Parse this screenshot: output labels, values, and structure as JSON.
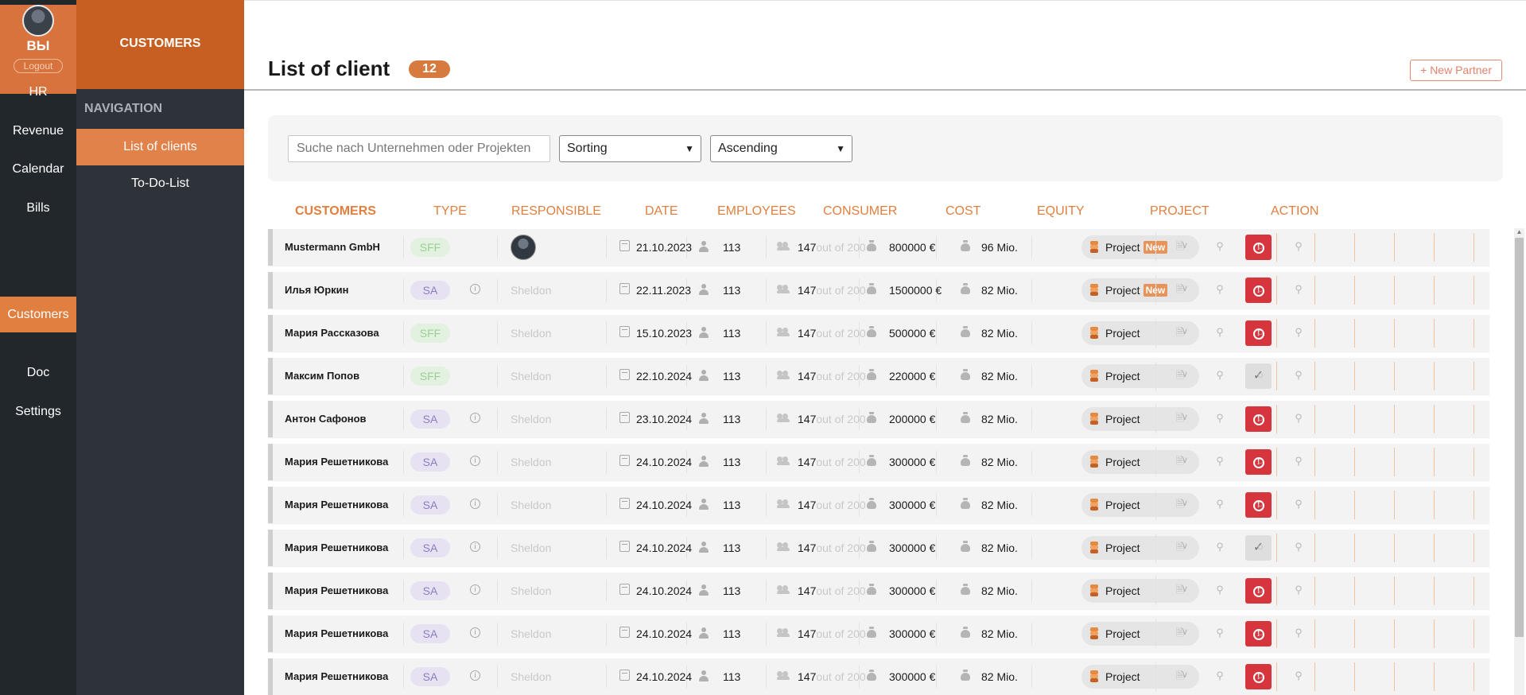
{
  "rail": {
    "initials": "ВЫ",
    "logout": "Logout",
    "items": [
      {
        "label": "HR",
        "active": false
      },
      {
        "label": "Revenue",
        "active": false
      },
      {
        "label": "Calendar",
        "active": false
      },
      {
        "label": "Bills",
        "active": false
      },
      {
        "label": "Customers",
        "active": true
      },
      {
        "label": "Doc",
        "active": false
      },
      {
        "label": "Settings",
        "active": false
      }
    ]
  },
  "subnav": {
    "title": "CUSTOMERS",
    "section": "NAVIGATION",
    "items": [
      {
        "label": "List of clients",
        "active": true
      },
      {
        "label": "To-Do-List",
        "active": false
      }
    ]
  },
  "header": {
    "title": "List of client",
    "count": "12",
    "new_partner": "+ New Partner"
  },
  "filters": {
    "search_placeholder": "Suche nach Unternehmen oder Projekten",
    "sorting": "Sorting",
    "order": "Ascending"
  },
  "columns": [
    "CUSTOMERS",
    "TYPE",
    "RESPONSIBLE",
    "DATE",
    "EMPLOYEES",
    "CONSUMER",
    "COST",
    "EQUITY",
    "PROJECT",
    "ACTION"
  ],
  "rows": [
    {
      "name": "Mustermann GmbH",
      "type": "SFF",
      "responsible": "",
      "avatar": true,
      "date": "21.10.2023",
      "employees": "113",
      "consumer": "147",
      "consumer_of": "out of 200",
      "cost": "800000 €",
      "equity": "96 Mio.",
      "project": "Project",
      "new": "New",
      "action": "alert"
    },
    {
      "name": "Илья Юркин",
      "type": "SA",
      "responsible": "Sheldon",
      "avatar": false,
      "date": "22.11.2023",
      "employees": "113",
      "consumer": "147",
      "consumer_of": "out of 200",
      "cost": "1500000 €",
      "equity": "82 Mio.",
      "project": "Project",
      "new": "New",
      "action": "alert"
    },
    {
      "name": "Мария Рассказова",
      "type": "SFF",
      "responsible": "Sheldon",
      "avatar": false,
      "date": "15.10.2023",
      "employees": "113",
      "consumer": "147",
      "consumer_of": "out of 200",
      "cost": "500000 €",
      "equity": "82 Mio.",
      "project": "Project",
      "new": "",
      "action": "alert"
    },
    {
      "name": "Максим Попов",
      "type": "SFF",
      "responsible": "Sheldon",
      "avatar": false,
      "date": "22.10.2024",
      "employees": "113",
      "consumer": "147",
      "consumer_of": "out of 200",
      "cost": "220000 €",
      "equity": "82 Mio.",
      "project": "Project",
      "new": "",
      "action": "check"
    },
    {
      "name": "Антон Сафонов",
      "type": "SA",
      "responsible": "Sheldon",
      "avatar": false,
      "date": "23.10.2024",
      "employees": "113",
      "consumer": "147",
      "consumer_of": "out of 200",
      "cost": "200000 €",
      "equity": "82 Mio.",
      "project": "Project",
      "new": "",
      "action": "alert"
    },
    {
      "name": "Мария Решетникова",
      "type": "SA",
      "responsible": "Sheldon",
      "avatar": false,
      "date": "24.10.2024",
      "employees": "113",
      "consumer": "147",
      "consumer_of": "out of 200",
      "cost": "300000 €",
      "equity": "82 Mio.",
      "project": "Project",
      "new": "",
      "action": "alert"
    },
    {
      "name": "Мария Решетникова",
      "type": "SA",
      "responsible": "Sheldon",
      "avatar": false,
      "date": "24.10.2024",
      "employees": "113",
      "consumer": "147",
      "consumer_of": "out of 200",
      "cost": "300000 €",
      "equity": "82 Mio.",
      "project": "Project",
      "new": "",
      "action": "alert"
    },
    {
      "name": "Мария Решетникова",
      "type": "SA",
      "responsible": "Sheldon",
      "avatar": false,
      "date": "24.10.2024",
      "employees": "113",
      "consumer": "147",
      "consumer_of": "out of 200",
      "cost": "300000 €",
      "equity": "82 Mio.",
      "project": "Project",
      "new": "",
      "action": "check"
    },
    {
      "name": "Мария Решетникова",
      "type": "SA",
      "responsible": "Sheldon",
      "avatar": false,
      "date": "24.10.2024",
      "employees": "113",
      "consumer": "147",
      "consumer_of": "out of 200",
      "cost": "300000 €",
      "equity": "82 Mio.",
      "project": "Project",
      "new": "",
      "action": "alert"
    },
    {
      "name": "Мария Решетникова",
      "type": "SA",
      "responsible": "Sheldon",
      "avatar": false,
      "date": "24.10.2024",
      "employees": "113",
      "consumer": "147",
      "consumer_of": "out of 200",
      "cost": "300000 €",
      "equity": "82 Mio.",
      "project": "Project",
      "new": "",
      "action": "alert"
    },
    {
      "name": "Мария Решетникова",
      "type": "SA",
      "responsible": "Sheldon",
      "avatar": false,
      "date": "24.10.2024",
      "employees": "113",
      "consumer": "147",
      "consumer_of": "out of 200",
      "cost": "300000 €",
      "equity": "82 Mio.",
      "project": "Project",
      "new": "",
      "action": "alert"
    }
  ],
  "colors": {
    "accent": "#e07f3f",
    "rail_bg": "#22272c",
    "subnav_bg": "#2d3339",
    "alert": "#d6353d"
  }
}
